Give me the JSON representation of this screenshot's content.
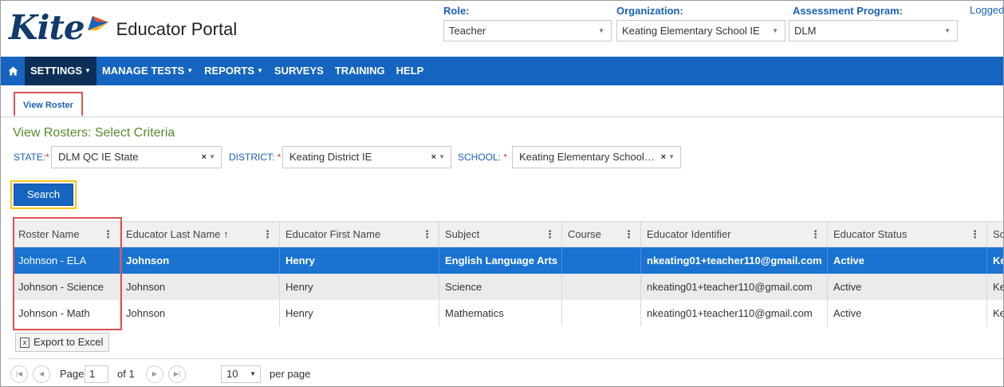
{
  "header": {
    "logo_text": "Kite",
    "portal_title": "Educator Portal",
    "role_label": "Role:",
    "role_value": "Teacher",
    "org_label": "Organization:",
    "org_value": "Keating Elementary School IE",
    "program_label": "Assessment Program:",
    "program_value": "DLM",
    "logged_in": "Logged"
  },
  "nav": {
    "home_icon": "home-icon",
    "items": [
      {
        "label": "SETTINGS",
        "dropdown": true,
        "active": true
      },
      {
        "label": "MANAGE TESTS",
        "dropdown": true
      },
      {
        "label": "REPORTS",
        "dropdown": true
      },
      {
        "label": "SURVEYS"
      },
      {
        "label": "TRAINING"
      },
      {
        "label": "HELP"
      }
    ]
  },
  "subtab": {
    "label": "View Roster"
  },
  "criteria": {
    "title": "View Rosters: Select Criteria",
    "state_label": "STATE:",
    "state_value": "DLM QC IE State",
    "district_label": "DISTRICT:",
    "district_value": "Keating District IE",
    "school_label": "SCHOOL:",
    "school_value": "Keating Elementary School…",
    "required_mark": "*",
    "clear_glyph": "×"
  },
  "search_button": "Search",
  "table": {
    "columns": [
      "Roster Name",
      "Educator Last Name ↑",
      "Educator First Name",
      "Subject",
      "Course",
      "Educator Identifier",
      "Educator Status",
      "Sc"
    ],
    "rows": [
      [
        "Johnson - ELA",
        "Johnson",
        "Henry",
        "English Language Arts",
        "",
        "nkeating01+teacher110@gmail.com",
        "Active",
        "Ke"
      ],
      [
        "Johnson - Science",
        "Johnson",
        "Henry",
        "Science",
        "",
        "nkeating01+teacher110@gmail.com",
        "Active",
        "Ke"
      ],
      [
        "Johnson - Math",
        "Johnson",
        "Henry",
        "Mathematics",
        "",
        "nkeating01+teacher110@gmail.com",
        "Active",
        "Ke"
      ]
    ],
    "selected_row": 0
  },
  "export_button": "Export to Excel",
  "pager": {
    "page_label": "Page",
    "page_value": "1",
    "of_label": "of 1",
    "page_size": "10",
    "per_page_label": "per page"
  },
  "colors": {
    "nav_bg": "#1565c0",
    "nav_active": "#0d2e57",
    "selected_row": "#1a73d1",
    "highlight_red": "#e05050",
    "highlight_yellow": "#f5c518",
    "criteria_title": "#5a8a2e"
  }
}
